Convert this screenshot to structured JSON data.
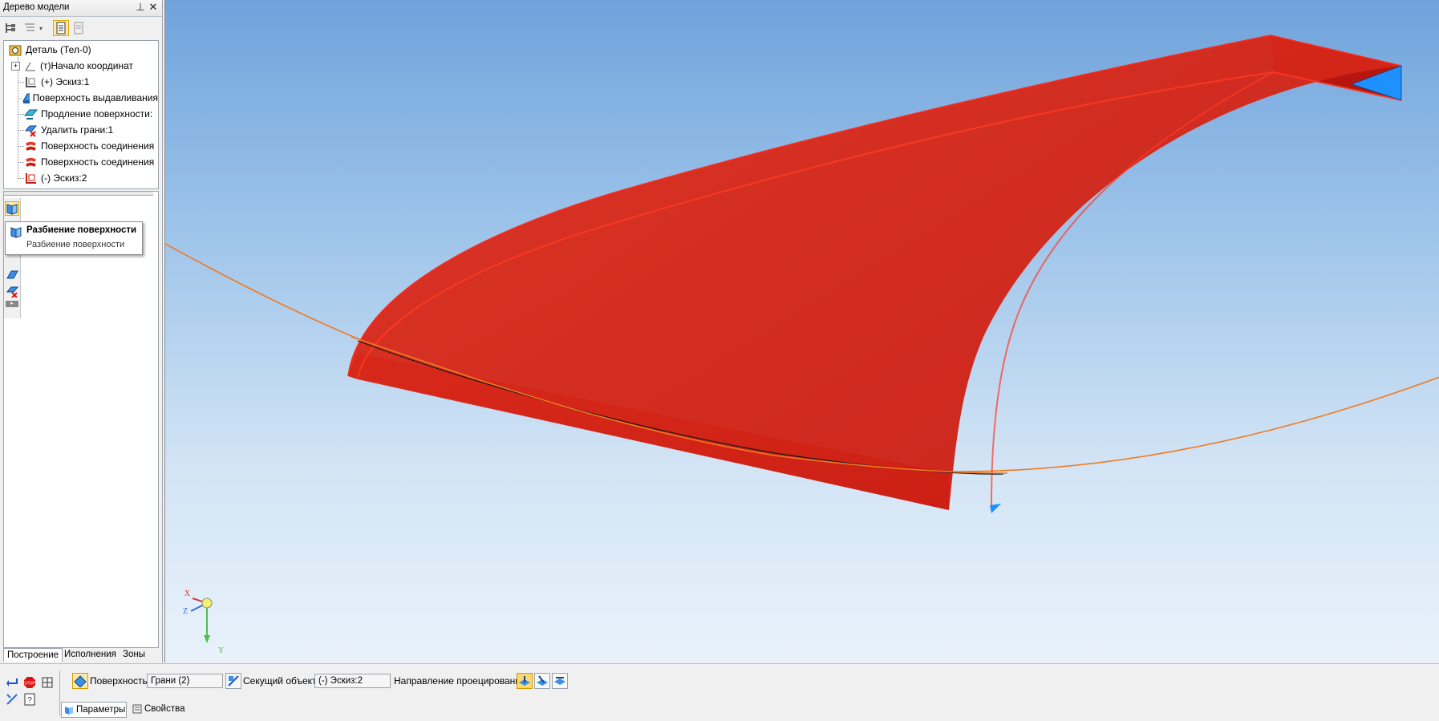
{
  "tree_panel": {
    "title": "Дерево модели",
    "pin_glyph": "⊥",
    "close_glyph": "✕",
    "items": [
      {
        "label": "Деталь (Тел-0)",
        "icon": "part-icon"
      },
      {
        "label": "(т)Начало координат",
        "icon": "origin-icon"
      },
      {
        "label": "(+) Эскиз:1",
        "icon": "sketch-icon"
      },
      {
        "label": "Поверхность выдавливания",
        "icon": "extrude-surface-icon"
      },
      {
        "label": "Продление поверхности:",
        "icon": "extend-surface-icon"
      },
      {
        "label": "Удалить грани:1",
        "icon": "delete-faces-icon"
      },
      {
        "label": "Поверхность соединения",
        "icon": "join-surface-icon"
      },
      {
        "label": "Поверхность соединения",
        "icon": "join-surface-icon"
      },
      {
        "label": "(-) Эскиз:2",
        "icon": "sketch-error-icon"
      }
    ],
    "tooltip": {
      "title": "Разбиение поверхности",
      "subtitle": "Разбиение поверхности"
    },
    "tabs": [
      "Построение",
      "Исполнения",
      "Зоны"
    ]
  },
  "viewport": {
    "axis_labels": {
      "x": "X",
      "y": "Y",
      "z": "Z"
    },
    "colors": {
      "surface": "#d9231a",
      "surface_edge": "#ff2a1a",
      "cut_face": "#1e90ff",
      "curve": "#f07a20"
    }
  },
  "property_bar": {
    "surface_label": "Поверхность",
    "surface_value": "Грани (2)",
    "cutting_label": "Секущий объект",
    "cutting_value": "(-) Эскиз:2",
    "direction_label": "Направление проецирования",
    "tabs": [
      "Параметры",
      "Свойства"
    ]
  }
}
